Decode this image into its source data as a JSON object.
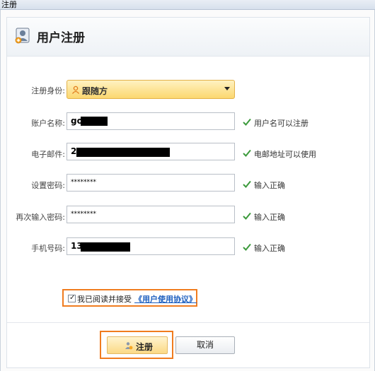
{
  "window": {
    "title": "注册"
  },
  "header": {
    "title": "用户注册",
    "icon": "user-register-icon"
  },
  "form": {
    "role": {
      "label": "注册身份:",
      "value": "跟随方",
      "icon": "person-icon"
    },
    "account": {
      "label": "账户名称:",
      "value": "go",
      "hint": "用户名可以注册"
    },
    "email": {
      "label": "电子邮件:",
      "value": "2",
      "hint": "电邮地址可以使用"
    },
    "password": {
      "label": "设置密码:",
      "value": "********",
      "hint": "输入正确"
    },
    "password_confirm": {
      "label": "再次输入密码:",
      "value": "********",
      "hint": "输入正确"
    },
    "phone": {
      "label": "手机号码:",
      "value": "13",
      "hint": "输入正确"
    }
  },
  "agreement": {
    "checked": true,
    "text": "我已阅读并接受",
    "link": "《用户使用协议》"
  },
  "buttons": {
    "submit": "注册",
    "cancel": "取消"
  },
  "colors": {
    "highlight": "#f07c1f",
    "valid_check": "#3c9a3c",
    "link": "#1d5fbf"
  }
}
